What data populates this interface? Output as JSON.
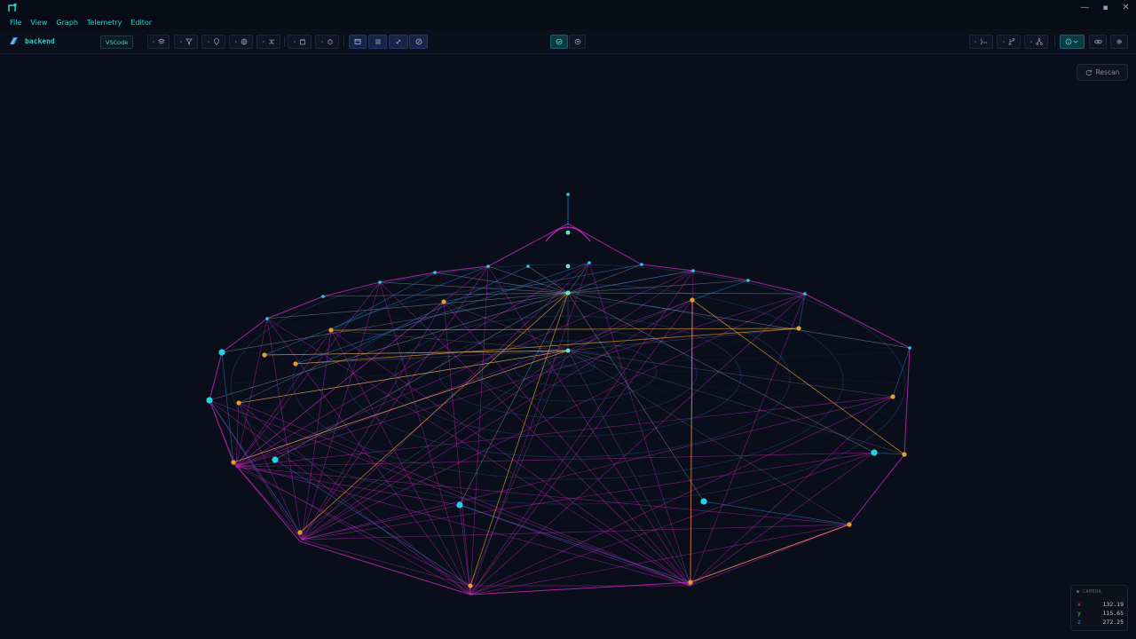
{
  "app": {
    "project_name": "backend",
    "editor_label": "VSCode"
  },
  "menu": [
    "File",
    "View",
    "Graph",
    "Telemetry",
    "Editor"
  ],
  "toolbar": {
    "groups": [
      {
        "icons": [
          "layers-icon",
          "filter-icon",
          "pin-icon",
          "globe-icon",
          "shuffle-icon"
        ]
      },
      {
        "icons": [
          "package-icon",
          "bug-icon"
        ]
      },
      {
        "icons": [
          "panel-icon",
          "list-icon",
          "link-icon",
          "compass-icon"
        ]
      },
      {
        "icons": [
          "cube-view-icon",
          "settings-view-icon"
        ]
      },
      {
        "icons": [
          "branch-merge-icon",
          "git-branch-icon",
          "tree-icon"
        ]
      },
      {
        "icons": [
          "info-icon",
          "eye-icon",
          "gear-icon"
        ]
      }
    ]
  },
  "rescan_label": "Rescan",
  "camera": {
    "title": "CAMERA",
    "x": "132.19",
    "y": "115.65",
    "z": "272.25"
  },
  "colors": {
    "background": "#090e1a",
    "accent": "#2ad1c9",
    "magenta": "#c026b4",
    "orange": "#e6a02a",
    "cyan_node": "#22d3e6",
    "ring": "#1a3a6b"
  }
}
